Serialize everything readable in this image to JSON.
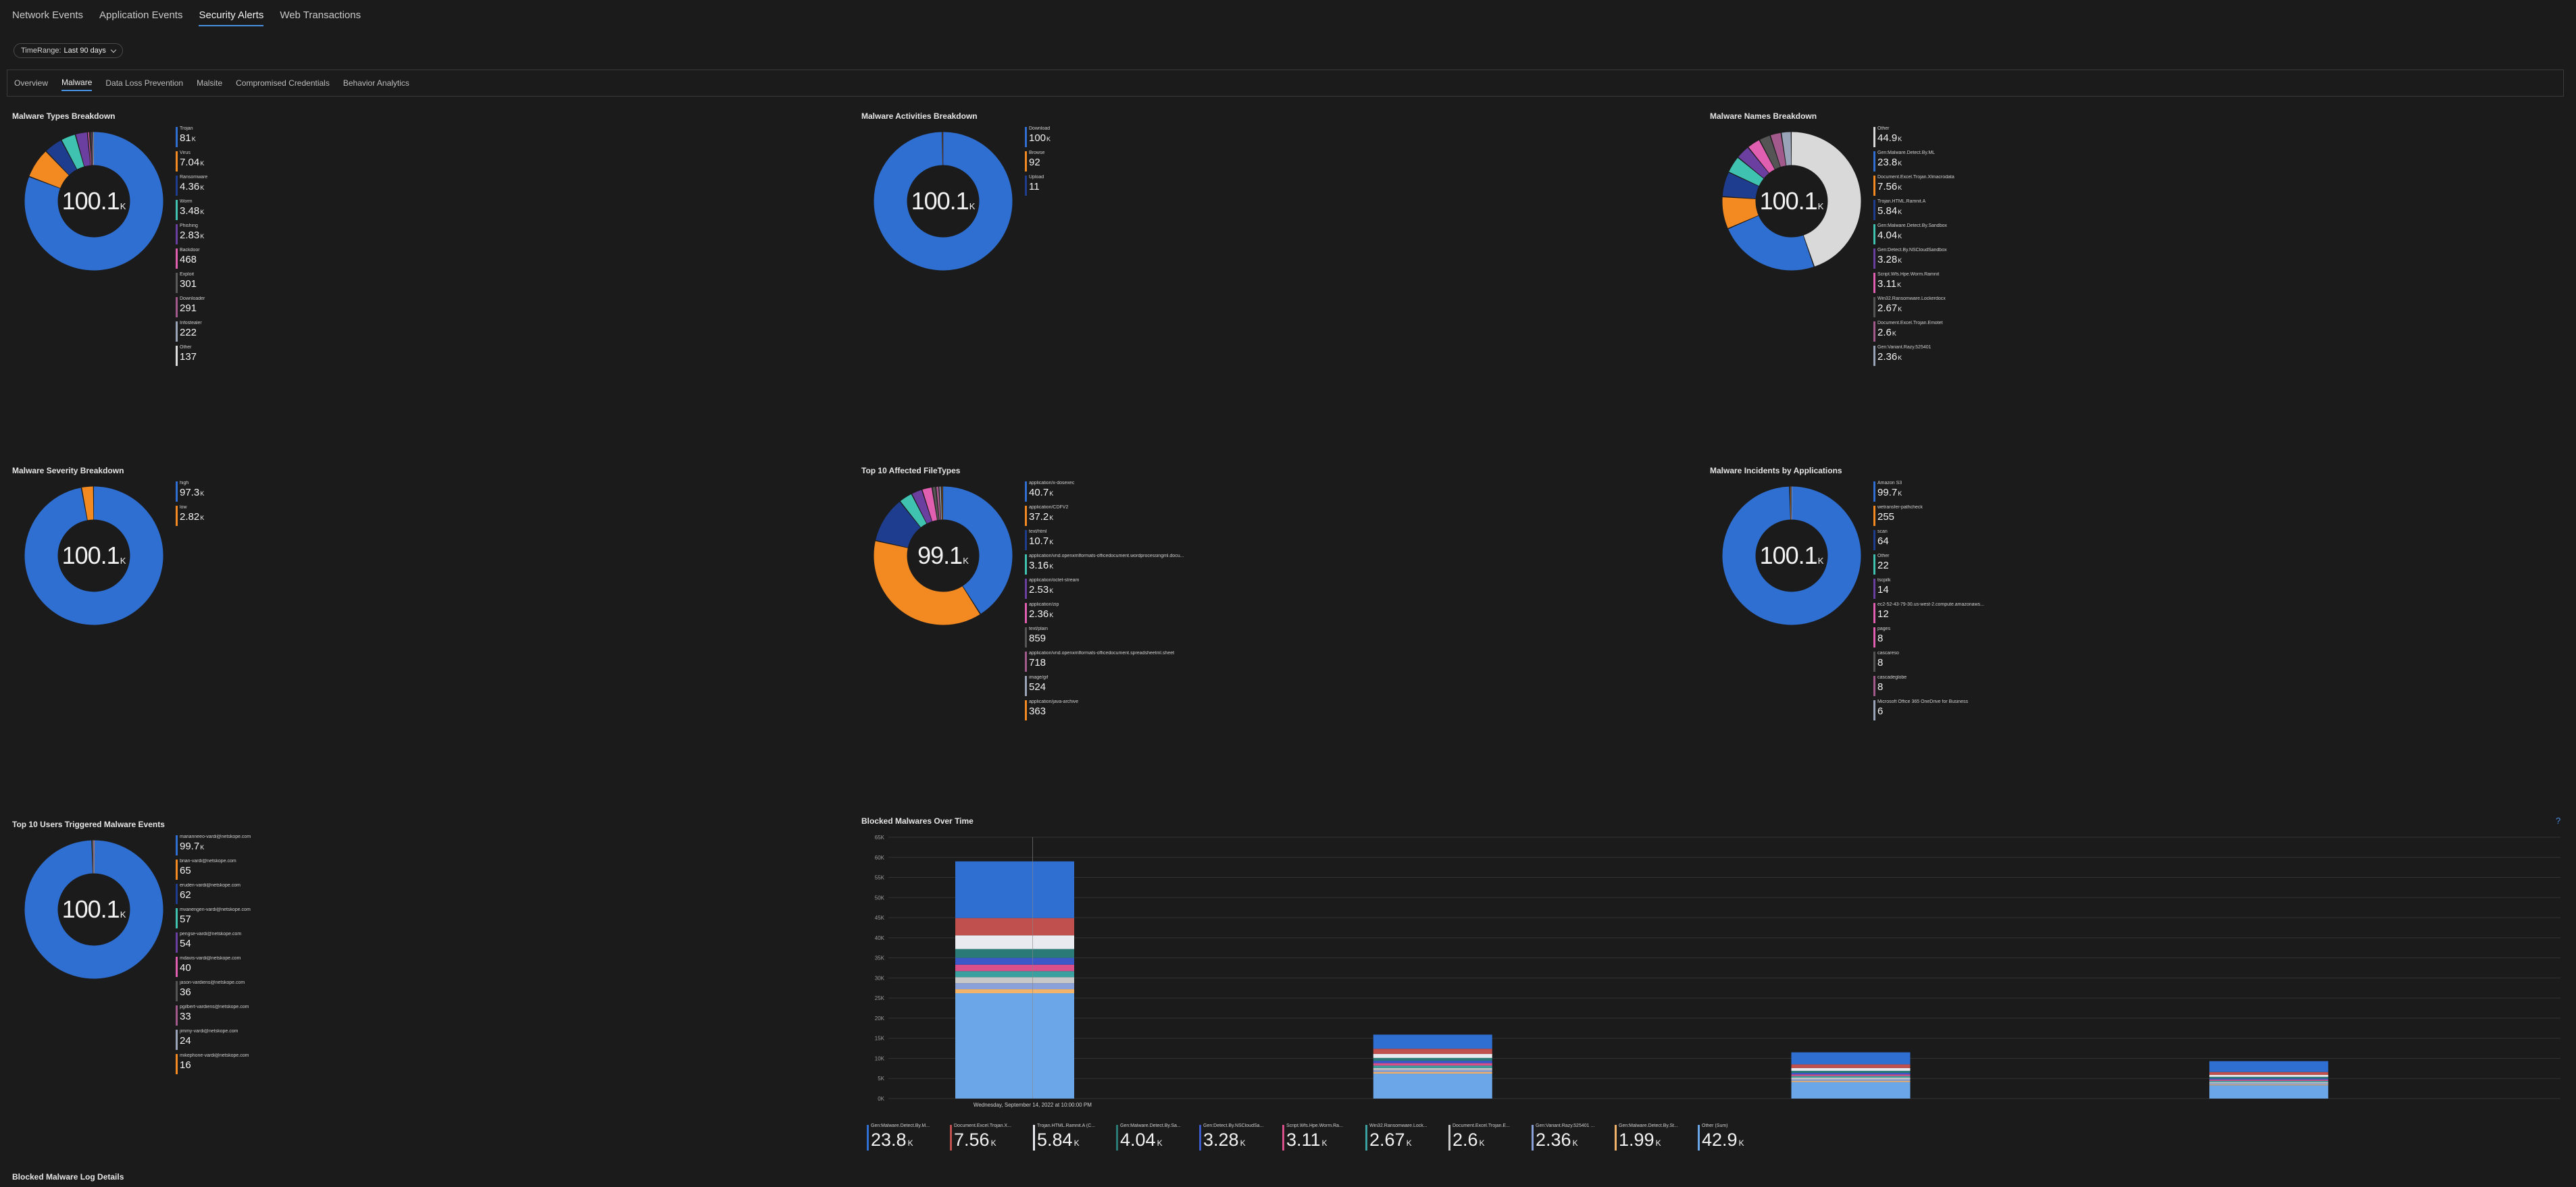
{
  "nav": {
    "tabs": [
      {
        "label": "Network Events"
      },
      {
        "label": "Application Events"
      },
      {
        "label": "Security Alerts"
      },
      {
        "label": "Web Transactions"
      }
    ]
  },
  "timerange": {
    "label": "TimeRange:",
    "value": "Last 90 days"
  },
  "subtabs": [
    {
      "label": "Overview"
    },
    {
      "label": "Malware"
    },
    {
      "label": "Data Loss Prevention"
    },
    {
      "label": "Malsite"
    },
    {
      "label": "Compromised Credentials"
    },
    {
      "label": "Behavior Analytics"
    }
  ],
  "colors": {
    "accent": "#4a90e2",
    "background": "#1b1b1b"
  },
  "panels": [
    {
      "title": "Malware Types Breakdown",
      "center_value": "100.1",
      "center_unit": "K",
      "legend": [
        {
          "name": "Trojan",
          "value": "81",
          "unit": "K",
          "color": "#2f6fd1"
        },
        {
          "name": "Virus",
          "value": "7.04",
          "unit": "K",
          "color": "#f28a21"
        },
        {
          "name": "Ransomware",
          "value": "4.36",
          "unit": "K",
          "color": "#1f3d8f"
        },
        {
          "name": "Worm",
          "value": "3.48",
          "unit": "K",
          "color": "#3fc2b0"
        },
        {
          "name": "Phishing",
          "value": "2.83",
          "unit": "K",
          "color": "#6b3fa0"
        },
        {
          "name": "Backdoor",
          "value": "468",
          "unit": "",
          "color": "#e05fb0"
        },
        {
          "name": "Exploit",
          "value": "301",
          "unit": "",
          "color": "#5a5a5a"
        },
        {
          "name": "Downloader",
          "value": "291",
          "unit": "",
          "color": "#a25a8c"
        },
        {
          "name": "Infostealer",
          "value": "222",
          "unit": "",
          "color": "#9aa4b8"
        },
        {
          "name": "Other",
          "value": "137",
          "unit": "",
          "color": "#dddddd"
        }
      ]
    },
    {
      "title": "Malware Activities Breakdown",
      "center_value": "100.1",
      "center_unit": "K",
      "legend": [
        {
          "name": "Download",
          "value": "100",
          "unit": "K",
          "color": "#2f6fd1"
        },
        {
          "name": "Browse",
          "value": "92",
          "unit": "",
          "color": "#f28a21"
        },
        {
          "name": "Upload",
          "value": "11",
          "unit": "",
          "color": "#1f3d8f"
        }
      ]
    },
    {
      "title": "Malware Names Breakdown",
      "center_value": "100.1",
      "center_unit": "K",
      "legend": [
        {
          "name": "Other",
          "value": "44.9",
          "unit": "K",
          "color": "#d9d9d9"
        },
        {
          "name": "Gen:Malware.Detect.By.ML",
          "value": "23.8",
          "unit": "K",
          "color": "#2f6fd1"
        },
        {
          "name": "Document.Excel.Trojan.Xlmacrodata",
          "value": "7.56",
          "unit": "K",
          "color": "#f28a21"
        },
        {
          "name": "Trojan.HTML.Ramnit.A",
          "value": "5.84",
          "unit": "K",
          "color": "#1f3d8f"
        },
        {
          "name": "Gen:Malware.Detect.By.Sandbox",
          "value": "4.04",
          "unit": "K",
          "color": "#3fc2b0"
        },
        {
          "name": "Gen:Detect.By.NSCloudSandbox",
          "value": "3.28",
          "unit": "K",
          "color": "#6b3fa0"
        },
        {
          "name": "Script.Wfs.Hpe.Worm.Ramnit",
          "value": "3.11",
          "unit": "K",
          "color": "#e05fb0"
        },
        {
          "name": "Win32.Ransomware.Lockerdocx",
          "value": "2.67",
          "unit": "K",
          "color": "#555555"
        },
        {
          "name": "Document.Excel.Trojan.Emotet",
          "value": "2.6",
          "unit": "K",
          "color": "#a25a8c"
        },
        {
          "name": "Gen:Variant.Razy.525401",
          "value": "2.36",
          "unit": "K",
          "color": "#9aa4b8"
        }
      ]
    },
    {
      "title": "Malware Severity Breakdown",
      "center_value": "100.1",
      "center_unit": "K",
      "legend": [
        {
          "name": "high",
          "value": "97.3",
          "unit": "K",
          "color": "#2f6fd1"
        },
        {
          "name": "low",
          "value": "2.82",
          "unit": "K",
          "color": "#f28a21"
        }
      ]
    },
    {
      "title": "Top 10 Affected FileTypes",
      "center_value": "99.1",
      "center_unit": "K",
      "legend": [
        {
          "name": "application/x-dosexec",
          "value": "40.7",
          "unit": "K",
          "color": "#2f6fd1"
        },
        {
          "name": "application/CDFV2",
          "value": "37.2",
          "unit": "K",
          "color": "#f28a21"
        },
        {
          "name": "text/html",
          "value": "10.7",
          "unit": "K",
          "color": "#1f3d8f"
        },
        {
          "name": "application/vnd.openxmlformats-officedocument.wordprocessingml.docu...",
          "value": "3.16",
          "unit": "K",
          "color": "#3fc2b0"
        },
        {
          "name": "application/octet-stream",
          "value": "2.53",
          "unit": "K",
          "color": "#6b3fa0"
        },
        {
          "name": "application/zip",
          "value": "2.36",
          "unit": "K",
          "color": "#e05fb0"
        },
        {
          "name": "text/plain",
          "value": "859",
          "unit": "",
          "color": "#555555"
        },
        {
          "name": "application/vnd.openxmlformats-officedocument.spreadsheetml.sheet",
          "value": "718",
          "unit": "",
          "color": "#a25a8c"
        },
        {
          "name": "image/gif",
          "value": "524",
          "unit": "",
          "color": "#9aa4b8"
        },
        {
          "name": "application/java-archive",
          "value": "363",
          "unit": "",
          "color": "#f28a21"
        }
      ]
    },
    {
      "title": "Malware Incidents by Applications",
      "center_value": "100.1",
      "center_unit": "K",
      "legend": [
        {
          "name": "Amazon S3",
          "value": "99.7",
          "unit": "K",
          "color": "#2f6fd1"
        },
        {
          "name": "wetransfer-pathcheck",
          "value": "255",
          "unit": "",
          "color": "#f28a21"
        },
        {
          "name": "scan",
          "value": "64",
          "unit": "",
          "color": "#1f3d8f"
        },
        {
          "name": "Other",
          "value": "22",
          "unit": "",
          "color": "#3fc2b0"
        },
        {
          "name": "tscpilk",
          "value": "14",
          "unit": "",
          "color": "#6b3fa0"
        },
        {
          "name": "ec2-52-43-79-30.us-west-2.compute.amazonaws...",
          "value": "12",
          "unit": "",
          "color": "#e05fb0"
        },
        {
          "name": "pages",
          "value": "8",
          "unit": "",
          "color": "#e05fb0"
        },
        {
          "name": "cascareso",
          "value": "8",
          "unit": "",
          "color": "#555555"
        },
        {
          "name": "cascadeglobe",
          "value": "8",
          "unit": "",
          "color": "#a25a8c"
        },
        {
          "name": "Microsoft Office 365 OneDrive for Business",
          "value": "6",
          "unit": "",
          "color": "#9aa4b8"
        }
      ]
    },
    {
      "title": "Top 10 Users Triggered Malware Events",
      "center_value": "100.1",
      "center_unit": "K",
      "legend": [
        {
          "name": "marianneeo-vardi@netskope.com",
          "value": "99.7",
          "unit": "K",
          "color": "#2f6fd1"
        },
        {
          "name": "brian-vardi@netskope.com",
          "value": "65",
          "unit": "",
          "color": "#f28a21"
        },
        {
          "name": "eruden-vardi@netskope.com",
          "value": "62",
          "unit": "",
          "color": "#1f3d8f"
        },
        {
          "name": "mvanengen-vardi@netskope.com",
          "value": "57",
          "unit": "",
          "color": "#3fc2b0"
        },
        {
          "name": "pengse-vardi@netskope.com",
          "value": "54",
          "unit": "",
          "color": "#6b3fa0"
        },
        {
          "name": "mdavis-vardi@netskope.com",
          "value": "40",
          "unit": "",
          "color": "#e05fb0"
        },
        {
          "name": "jason-vardiens@netskope.com",
          "value": "36",
          "unit": "",
          "color": "#555555"
        },
        {
          "name": "pgilbert-vardiens@netskope.com",
          "value": "33",
          "unit": "",
          "color": "#a25a8c"
        },
        {
          "name": "jimmy-vardi@netskope.com",
          "value": "24",
          "unit": "",
          "color": "#9aa4b8"
        },
        {
          "name": "mikephone-vardi@netskope.com",
          "value": "16",
          "unit": "",
          "color": "#f28a21"
        }
      ]
    }
  ],
  "timeseries": {
    "title": "Blocked Malwares Over Time",
    "hover_label": "Wednesday, September 14, 2022 at 10:00:00 PM",
    "legend": [
      {
        "name": "Gen:Malware.Detect.By.M...",
        "value": "23.8",
        "unit": "K",
        "color": "#2f6fd1"
      },
      {
        "name": "Document.Excel.Trojan.X...",
        "value": "7.56",
        "unit": "K",
        "color": "#c0504d"
      },
      {
        "name": "Trojan.HTML.Ramnit.A (C...",
        "value": "5.84",
        "unit": "K",
        "color": "#e8eaf0"
      },
      {
        "name": "Gen:Malware.Detect.By.Sa...",
        "value": "4.04",
        "unit": "K",
        "color": "#2a7a78"
      },
      {
        "name": "Gen:Detect.By.NSCloudSa...",
        "value": "3.28",
        "unit": "K",
        "color": "#3a58c8"
      },
      {
        "name": "Script.Wfs.Hpe.Worm.Ra...",
        "value": "3.11",
        "unit": "K",
        "color": "#d94f8a"
      },
      {
        "name": "Win32.Ransomware.Lock...",
        "value": "2.67",
        "unit": "K",
        "color": "#3aa0a0"
      },
      {
        "name": "Document.Excel.Trojan.E...",
        "value": "2.6",
        "unit": "K",
        "color": "#c8c8c8"
      },
      {
        "name": "Gen:Variant.Razy.525401 ...",
        "value": "2.36",
        "unit": "K",
        "color": "#8aa0d8"
      },
      {
        "name": "Gen:Malware.Detect.By.St...",
        "value": "1.99",
        "unit": "K",
        "color": "#f2b46a"
      },
      {
        "name": "Other (Sum)",
        "value": "42.9",
        "unit": "K",
        "color": "#6ba7e8"
      }
    ]
  },
  "chart_data": {
    "type": "bar",
    "title": "Blocked Malwares Over Time",
    "y_ticks": [
      "65K",
      "60K",
      "55K",
      "50K",
      "45K",
      "40K",
      "35K",
      "30K",
      "25K",
      "20K",
      "15K",
      "10K",
      "5K",
      "0K"
    ],
    "ylim": [
      0,
      65000
    ],
    "categories": [
      "bar1",
      "bar2",
      "bar3",
      "bar4"
    ],
    "categories_visible": false,
    "series": [
      {
        "name": "Other (Sum)",
        "color": "#6ba7e8",
        "values": [
          26200,
          6200,
          4100,
          3300
        ]
      },
      {
        "name": "Gen:Malware.Detect.By.St...",
        "color": "#f2b46a",
        "values": [
          1000,
          400,
          300,
          200
        ]
      },
      {
        "name": "Gen:Variant.Razy.525401 ...",
        "color": "#8aa0d8",
        "values": [
          1500,
          500,
          400,
          300
        ]
      },
      {
        "name": "Document.Excel.Trojan.E...",
        "color": "#c8c8c8",
        "values": [
          1500,
          500,
          400,
          300
        ]
      },
      {
        "name": "Win32.Ransomware.Lock...",
        "color": "#3aa0a0",
        "values": [
          1500,
          600,
          400,
          300
        ]
      },
      {
        "name": "Script.Wfs.Hpe.Worm.Ra...",
        "color": "#d94f8a",
        "values": [
          1600,
          600,
          400,
          300
        ]
      },
      {
        "name": "Gen:Detect.By.NSCloudSa...",
        "color": "#3a58c8",
        "values": [
          1700,
          600,
          400,
          300
        ]
      },
      {
        "name": "Gen:Malware.Detect.By.Sa...",
        "color": "#2a7a78",
        "values": [
          2200,
          700,
          500,
          400
        ]
      },
      {
        "name": "Trojan.HTML.Ramnit.A (C...",
        "color": "#e8eaf0",
        "values": [
          3400,
          1000,
          700,
          500
        ]
      },
      {
        "name": "Document.Excel.Trojan.X...",
        "color": "#c0504d",
        "values": [
          4300,
          1300,
          900,
          700
        ]
      },
      {
        "name": "Gen:Malware.Detect.By.M...",
        "color": "#2f6fd1",
        "values": [
          14100,
          3500,
          3000,
          2700
        ]
      }
    ]
  },
  "bottom_section": {
    "title": "Blocked Malware Log Details"
  }
}
